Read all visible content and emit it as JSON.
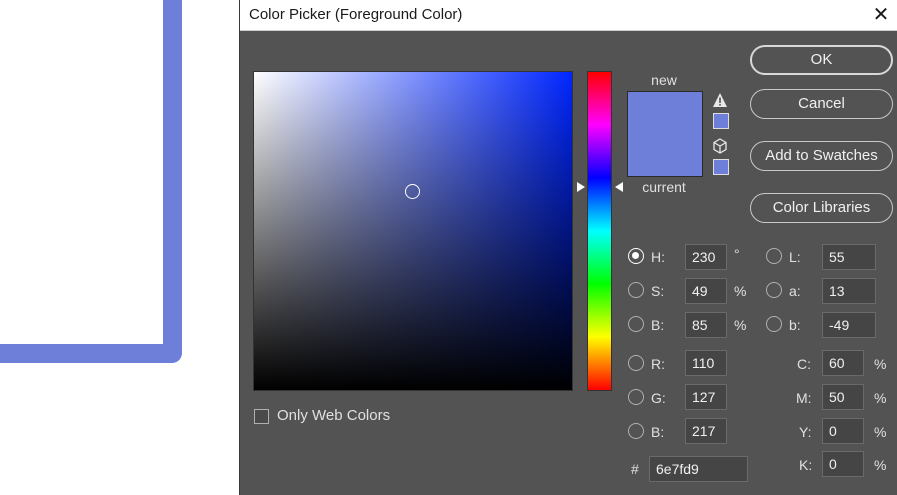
{
  "dialog": {
    "title": "Color Picker (Foreground Color)",
    "close_glyph": "✕"
  },
  "colors": {
    "new": "#6e7fd9",
    "current": "#6e7fd9",
    "canvas_border": "#6e7fd9",
    "hue_pure": "#0026ff"
  },
  "swatches": {
    "new_label": "new",
    "current_label": "current",
    "gamut_warning_icon": "warning-triangle-icon",
    "web_safe_icon": "cube-icon"
  },
  "buttons": {
    "ok": "OK",
    "cancel": "Cancel",
    "add_to_swatches": "Add to Swatches",
    "color_libraries": "Color Libraries"
  },
  "hsb": {
    "h_label": "H:",
    "h_value": "230",
    "h_unit": "°",
    "s_label": "S:",
    "s_value": "49",
    "s_unit": "%",
    "b_label": "B:",
    "b_value": "85",
    "b_unit": "%",
    "selected": "H"
  },
  "lab": {
    "l_label": "L:",
    "l_value": "55",
    "a_label": "a:",
    "a_value": "13",
    "b_label": "b:",
    "b_value": "-49"
  },
  "rgb": {
    "r_label": "R:",
    "r_value": "110",
    "g_label": "G:",
    "g_value": "127",
    "b_label": "B:",
    "b_value": "217"
  },
  "cmyk": {
    "c_label": "C:",
    "c_value": "60",
    "c_unit": "%",
    "m_label": "M:",
    "m_value": "50",
    "m_unit": "%",
    "y_label": "Y:",
    "y_value": "0",
    "y_unit": "%",
    "k_label": "K:",
    "k_value": "0",
    "k_unit": "%"
  },
  "hex": {
    "label": "#",
    "value": "6e7fd9"
  },
  "options": {
    "only_web_colors_label": "Only Web Colors",
    "only_web_colors_checked": false
  }
}
